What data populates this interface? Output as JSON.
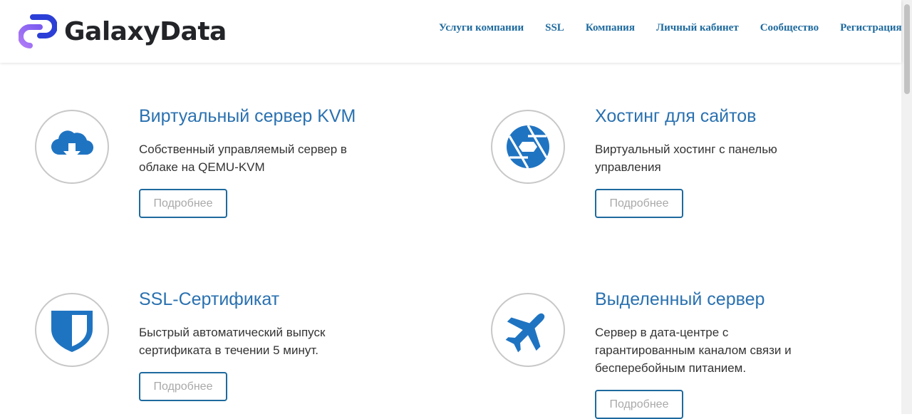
{
  "brand": {
    "name": "GalaxyData"
  },
  "nav": [
    {
      "label": "Услуги компании"
    },
    {
      "label": "SSL"
    },
    {
      "label": "Компания"
    },
    {
      "label": "Личный кабинет"
    },
    {
      "label": "Сообщество"
    },
    {
      "label": "Регистрация"
    }
  ],
  "cards": [
    {
      "title": "Виртуальный сервер KVM",
      "description": "Собственный управляемый сервер в облаке на QEMU-KVM",
      "button": "Подробнее",
      "icon": "cloud-download-icon"
    },
    {
      "title": "Хостинг для сайтов",
      "description": "Виртуальный хостинг с панелью управления",
      "button": "Подробнее",
      "icon": "aperture-icon"
    },
    {
      "title": "SSL-Сертификат",
      "description": "Быстрый автоматический выпуск сертификата в течении 5 минут.",
      "button": "Подробнее",
      "icon": "shield-icon"
    },
    {
      "title": "Выделенный сервер",
      "description": "Сервер в дата-центре с гарантированным каналом связи и бесперебойным питанием.",
      "button": "Подробнее",
      "icon": "airplane-icon"
    }
  ],
  "colors": {
    "accent": "#2a71b0",
    "nav": "#1e6a9e",
    "logo_dark": "#2b3fd6",
    "logo_light": "#9c6bf2"
  }
}
